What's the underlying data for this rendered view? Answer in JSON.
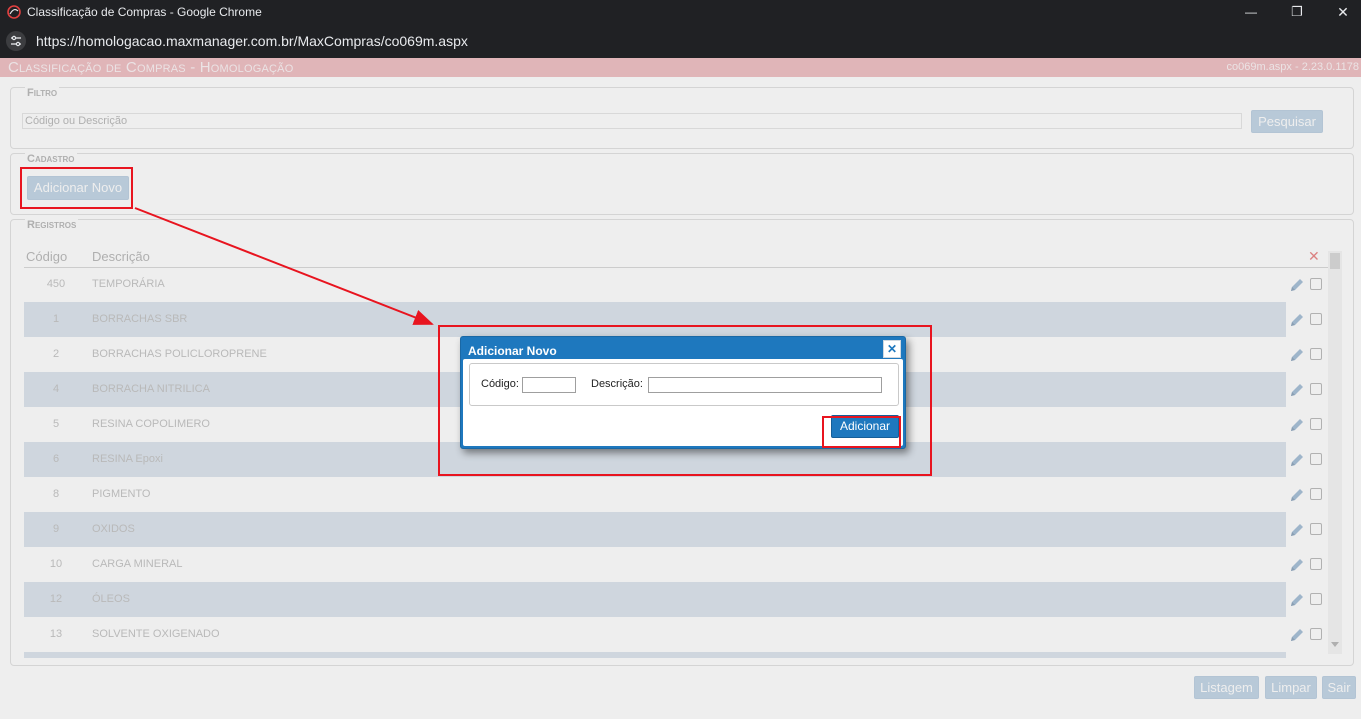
{
  "browser": {
    "window_title": "Classificação de Compras - Google Chrome",
    "url": "https://homologacao.maxmanager.com.br/MaxCompras/co069m.aspx",
    "controls": {
      "minimize": "—",
      "restore": "❐",
      "close": "✕"
    }
  },
  "header": {
    "title": "Classificação de Compras  - Homologação",
    "version": "co069m.aspx - 2.23.0.1178"
  },
  "filter": {
    "legend": "Filtro",
    "placeholder": "Código ou Descrição",
    "search_label": "Pesquisar"
  },
  "cadastro": {
    "legend": "Cadastro",
    "add_new_label": "Adicionar Novo"
  },
  "registros": {
    "legend": "Registros",
    "columns": [
      "Código",
      "Descrição"
    ],
    "delete_icon": "✕",
    "rows": [
      {
        "code": "450",
        "desc": "TEMPORÁRIA"
      },
      {
        "code": "1",
        "desc": "BORRACHAS SBR"
      },
      {
        "code": "2",
        "desc": "BORRACHAS POLICLOROPRENE"
      },
      {
        "code": "4",
        "desc": "BORRACHA NITRILICA"
      },
      {
        "code": "5",
        "desc": "RESINA COPOLIMERO"
      },
      {
        "code": "6",
        "desc": "RESINA Epoxi"
      },
      {
        "code": "8",
        "desc": "PIGMENTO"
      },
      {
        "code": "9",
        "desc": "OXIDOS"
      },
      {
        "code": "10",
        "desc": "CARGA MINERAL"
      },
      {
        "code": "12",
        "desc": "ÓLEOS"
      },
      {
        "code": "13",
        "desc": "SOLVENTE OXIGENADO"
      }
    ]
  },
  "footer": {
    "listagem": "Listagem",
    "limpar": "Limpar",
    "sair": "Sair"
  },
  "modal": {
    "title": "Adicionar Novo",
    "close": "✕",
    "codigo_label": "Código:",
    "descricao_label": "Descrição:",
    "submit_label": "Adicionar"
  },
  "colors": {
    "header_bg": "#e8a3a8",
    "modal_blue": "#1e78be",
    "row_alt": "#cdd9e5",
    "annotation_red": "#e8141f"
  }
}
